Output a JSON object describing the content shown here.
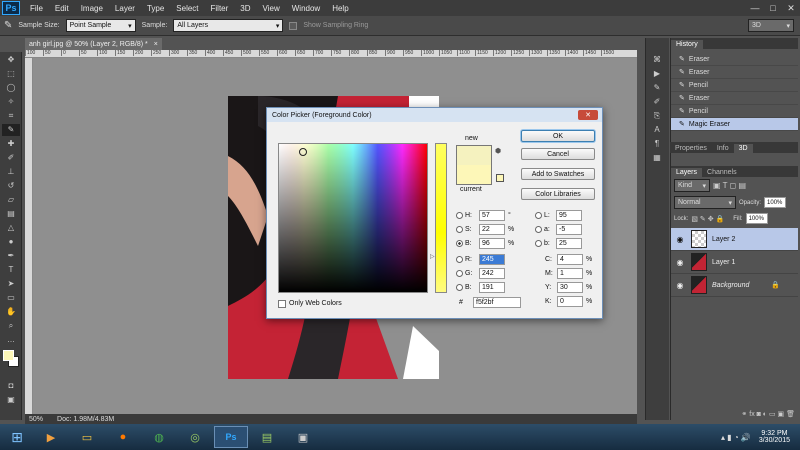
{
  "menubar": {
    "items": [
      "File",
      "Edit",
      "Image",
      "Layer",
      "Type",
      "Select",
      "Filter",
      "3D",
      "View",
      "Window",
      "Help"
    ]
  },
  "logo": "Ps",
  "options": {
    "sample_size_label": "Sample Size:",
    "sample_size_value": "Point Sample",
    "sample_label": "Sample:",
    "sample_value": "All Layers",
    "show_ring": "Show Sampling Ring",
    "workspace": "3D"
  },
  "document": {
    "tab": "anh girl.jpg @ 50% (Layer 2, RGB/8) *",
    "zoom": "50%",
    "doc_info": "Doc: 1.98M/4.83M"
  },
  "ruler_marks": [
    "100",
    "50",
    "0",
    "50",
    "100",
    "150",
    "200",
    "250",
    "300",
    "350",
    "400",
    "450",
    "500",
    "550",
    "600",
    "650",
    "700",
    "750",
    "800",
    "850",
    "900",
    "950",
    "1000",
    "1050",
    "1100",
    "1150",
    "1200",
    "1250",
    "1300",
    "1350",
    "1400",
    "1450",
    "1500"
  ],
  "history": {
    "tab": "History",
    "items": [
      "Eraser",
      "Eraser",
      "Pencil",
      "Eraser",
      "Pencil",
      "Magic Eraser"
    ]
  },
  "props_tabs": [
    "Properties",
    "Info",
    "3D"
  ],
  "layers": {
    "tabs": [
      "Layers",
      "Channels"
    ],
    "kind": "Kind",
    "blend": "Normal",
    "opacity_label": "Opacity:",
    "opacity": "100%",
    "lock_label": "Lock:",
    "fill_label": "Fill:",
    "fill": "100%",
    "items": [
      "Layer 2",
      "Layer 1",
      "Background"
    ]
  },
  "dialog": {
    "title": "Color Picker (Foreground Color)",
    "new_label": "new",
    "current_label": "current",
    "ok": "OK",
    "cancel": "Cancel",
    "add_swatches": "Add to Swatches",
    "libraries": "Color Libraries",
    "web_colors": "Only Web Colors",
    "h": "57",
    "h_unit": "°",
    "s": "22",
    "b": "96",
    "r": "245",
    "g": "242",
    "bb": "191",
    "l": "95",
    "a": "-5",
    "b2": "25",
    "c": "4",
    "m": "1",
    "y": "30",
    "k": "0",
    "hex": "f5f2bf",
    "pct": "%"
  },
  "taskbar": {
    "time": "9:32 PM",
    "date": "3/30/2015"
  },
  "colors": {
    "new_color": "#f5f2bf",
    "current_color": "#fdf7b8",
    "accent": "#31a8ff"
  }
}
